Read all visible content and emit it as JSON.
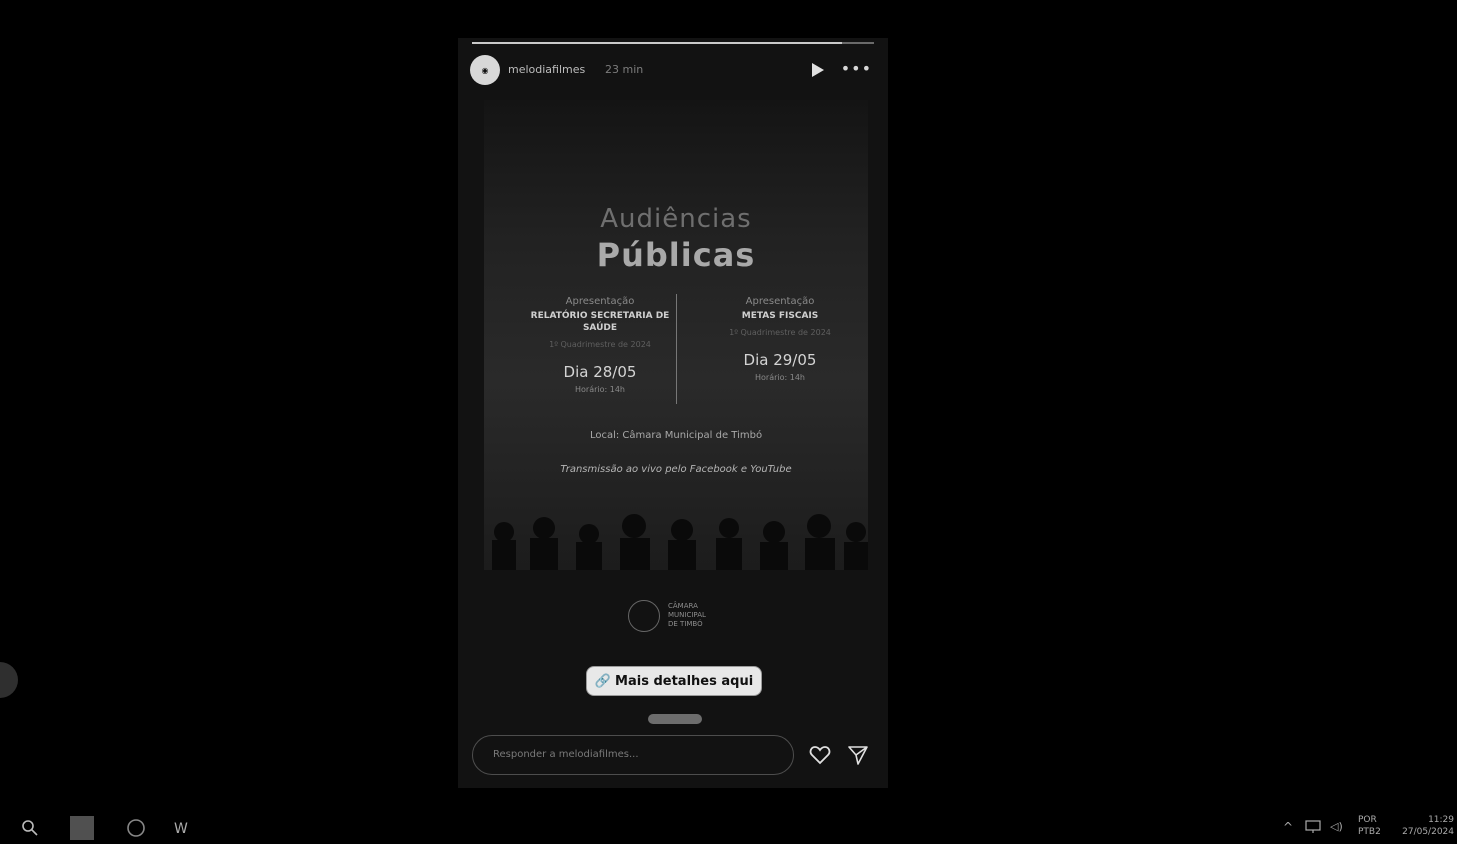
{
  "story": {
    "username": "melodiafilmes",
    "time": "23 min",
    "progress_fraction": 0.92
  },
  "poster": {
    "title_line1": "Audiências",
    "title_line2": "Públicas",
    "left": {
      "kicker": "Apresentação",
      "heading": "RELATÓRIO SECRETARIA DE SAÚDE",
      "sub": "1º Quadrimestre de 2024",
      "date": "Dia 28/05",
      "hour": "Horário: 14h"
    },
    "right": {
      "kicker": "Apresentação",
      "heading": "METAS FISCAIS",
      "sub": "1º Quadrimestre de 2024",
      "date": "Dia 29/05",
      "hour": "Horário: 14h"
    },
    "local": "Local: Câmara Municipal de Timbó",
    "transmit": "Transmissão ao vivo pelo Facebook e YouTube",
    "logo_text": [
      "CÂMARA",
      "MUNICIPAL",
      "DE TIMBÓ"
    ]
  },
  "link_sticker": {
    "label": "Mais detalhes aqui"
  },
  "reply": {
    "placeholder": "Responder a melodiafilmes..."
  },
  "icons": {
    "play": "play-icon",
    "more": "more-icon",
    "heart": "heart-icon",
    "send": "send-icon"
  },
  "taskbar": {
    "language": [
      "POR",
      "PTB2"
    ],
    "time": "11:29",
    "date": "27/05/2024"
  }
}
